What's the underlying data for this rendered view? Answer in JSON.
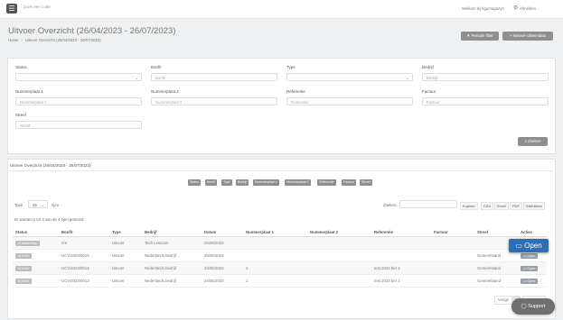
{
  "topbar": {
    "menu_icon": "☰",
    "search_placeholder": "Zoek een code",
    "welcome": "Welkom bij bgomagazyn",
    "settings_icon": "⚙",
    "logout": "Afmelden"
  },
  "header": {
    "title": "Uitvoer Overzicht (26/04/2023 - 26/07/2023)",
    "breadcrumb": [
      "Home",
      "Uitvoer Overzicht (26/04/2023 - 26/07/2023)"
    ],
    "periode_btn": "Periode filter",
    "nieuwe_btn": "Nieuwe uitleendata"
  },
  "filters": {
    "status_label": "Status",
    "bonfit_label": "Bonfit",
    "bonfit_ph": "Bonfit",
    "type_label": "Type",
    "bedrijf_label": "Bedrijf",
    "bedrijf_ph": "Bedrijf",
    "nr1_label": "Nummerplaat 1",
    "nr1_ph": "Nummerplaat 1",
    "nr2_label": "Nummerplaat 2",
    "nr2_ph": "Nummerplaat 2",
    "ref_label": "Referentie",
    "ref_ph": "Referentie",
    "factuur_label": "Factuur",
    "factuur_ph": "Factuur",
    "streef_label": "Streef",
    "streef_ph": "Streef",
    "zoeken_btn": "Zoeken"
  },
  "results": {
    "title": "Uitvoer Overzicht (26/04/2023 - 26/07/2023)",
    "col_buttons": [
      "Status",
      "Bonfit",
      "Type",
      "Bedrijf",
      "Nummerplaat 1",
      "Nummerplaat 2",
      "Referentie",
      "Factuur",
      "Streef"
    ],
    "toon": "Toon",
    "page_size": "25",
    "rijen": "rijen",
    "zoeken": "Zoeken:",
    "exports": [
      "Kopieer",
      "CSV",
      "Excel",
      "PDF",
      "Afdrukken"
    ],
    "info": "Er worden 1 tot 4 van de 4 rijen getoond",
    "columns": [
      "Status",
      "Bonfit",
      "Type",
      "Bedrijf",
      "Datum",
      "Nummerplaat 1",
      "Nummerplaat 2",
      "Referentie",
      "Factuur",
      "Streef",
      "Acties"
    ],
    "rows": [
      {
        "status": "In afwachting",
        "bonfit": "n/a",
        "type": "Uitvoer",
        "bedrijf": "Tech Lessons",
        "datum": "26/06/2023",
        "nr1": "",
        "nr2": "",
        "ref": "",
        "factuur": "",
        "streef": "",
        "actie": "Open"
      },
      {
        "status": "In Orde",
        "bonfit": "UCV/2023/0015",
        "type": "Uitvoer",
        "bedrijf": "Nederlands bedrijf",
        "datum": "25/05/2023",
        "nr1": "",
        "nr2": "",
        "ref": "",
        "factuur": "",
        "streef": "Gemeerlaand",
        "actie": "Open"
      },
      {
        "status": "In Orde",
        "bonfit": "UCV/2023/0014",
        "type": "Uitvoer",
        "bedrijf": "Nederlands bedrijf",
        "datum": "24/05/2023",
        "nr1": "2",
        "nr2": "",
        "ref": "test 2023 ber 2",
        "factuur": "",
        "streef": "Gemeerlaand",
        "actie": "Open"
      },
      {
        "status": "In Orde",
        "bonfit": "UCV/2023/0013",
        "type": "Uitvoer",
        "bedrijf": "Nederlands bedrijf",
        "datum": "24/05/2023",
        "nr1": "1",
        "nr2": "",
        "ref": "test 2023 ber 1",
        "factuur": "",
        "streef": "Gemeerlaand",
        "actie": "Open"
      }
    ],
    "open_big": "Open",
    "pager": {
      "prev": "Vorige",
      "page": "1",
      "next": "Volgende"
    }
  },
  "support": "Support"
}
